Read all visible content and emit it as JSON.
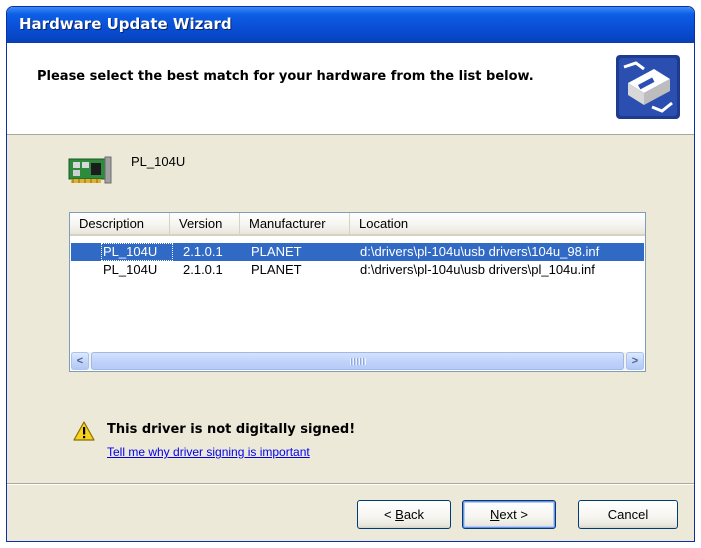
{
  "window": {
    "title": "Hardware Update Wizard"
  },
  "header": {
    "heading": "Please select the best match for your hardware from the list below.",
    "icon": "hardware-wizard-icon"
  },
  "device": {
    "name": "PL_104U",
    "icon": "network-card-icon"
  },
  "driver_list": {
    "columns": [
      "Description",
      "Version",
      "Manufacturer",
      "Location"
    ],
    "rows": [
      {
        "description": "PL_104U",
        "version": "2.1.0.1",
        "manufacturer": "PLANET",
        "location": "d:\\drivers\\pl-104u\\usb drivers\\104u_98.inf",
        "selected": true
      },
      {
        "description": "PL_104U",
        "version": "2.1.0.1",
        "manufacturer": "PLANET",
        "location": "d:\\drivers\\pl-104u\\usb drivers\\pl_104u.inf",
        "selected": false
      }
    ],
    "scroll_left_glyph": "<",
    "scroll_right_glyph": ">"
  },
  "warning": {
    "text": "This driver is not digitally signed!",
    "link": "Tell me why driver signing is important",
    "icon": "warning-icon"
  },
  "buttons": {
    "back": {
      "prefix": "< ",
      "mnemonic": "B",
      "rest": "ack"
    },
    "next": {
      "mnemonic": "N",
      "rest": "ext >"
    },
    "cancel": "Cancel"
  },
  "colors": {
    "title_bar": "#0a4fd6",
    "selection": "#316ac5",
    "dialog_bg": "#ece9d8",
    "link": "#0000ee"
  }
}
